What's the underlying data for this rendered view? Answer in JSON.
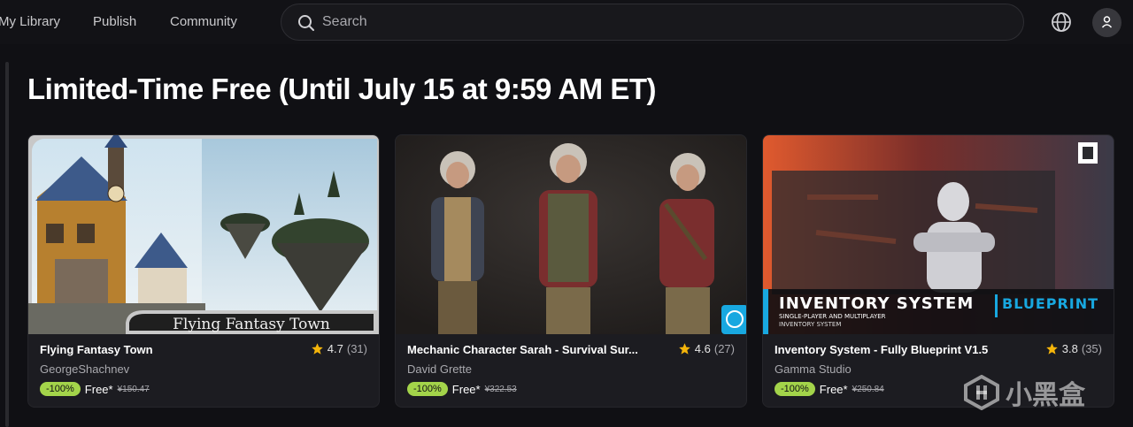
{
  "nav": {
    "items": [
      {
        "label": "My Library"
      },
      {
        "label": "Publish"
      },
      {
        "label": "Community"
      }
    ],
    "search": {
      "placeholder": "Search"
    }
  },
  "section": {
    "title": "Limited-Time Free (Until July 15 at 9:59 AM ET)"
  },
  "cards": [
    {
      "title": "Flying Fantasy Town",
      "thumb_caption": "Flying Fantasy Town",
      "rating": "4.7",
      "reviews": "(31)",
      "seller": "GeorgeShachnev",
      "discount": "-100%",
      "price": "Free*",
      "original_price": "¥150.47"
    },
    {
      "title": "Mechanic Character Sarah - Survival Sur...",
      "rating": "4.6",
      "reviews": "(27)",
      "seller": "David Grette",
      "discount": "-100%",
      "price": "Free*",
      "original_price": "¥322.53"
    },
    {
      "title": "Inventory System - Fully Blueprint V1.5",
      "thumb_caption_main": "INVENTORY SYSTEM",
      "thumb_caption_tag": "BLUEPRINT",
      "thumb_caption_sub1": "SINGLE-PLAYER AND MULTIPLAYER",
      "thumb_caption_sub2": "INVENTORY SYSTEM",
      "rating": "3.8",
      "reviews": "(35)",
      "seller": "Gamma Studio",
      "discount": "-100%",
      "price": "Free*",
      "original_price": "¥250.84"
    }
  ],
  "watermark": {
    "text": "小黑盒"
  },
  "colors": {
    "badge": "#a3d44a",
    "star": "#f5b50a",
    "accent": "#18a8e0"
  }
}
